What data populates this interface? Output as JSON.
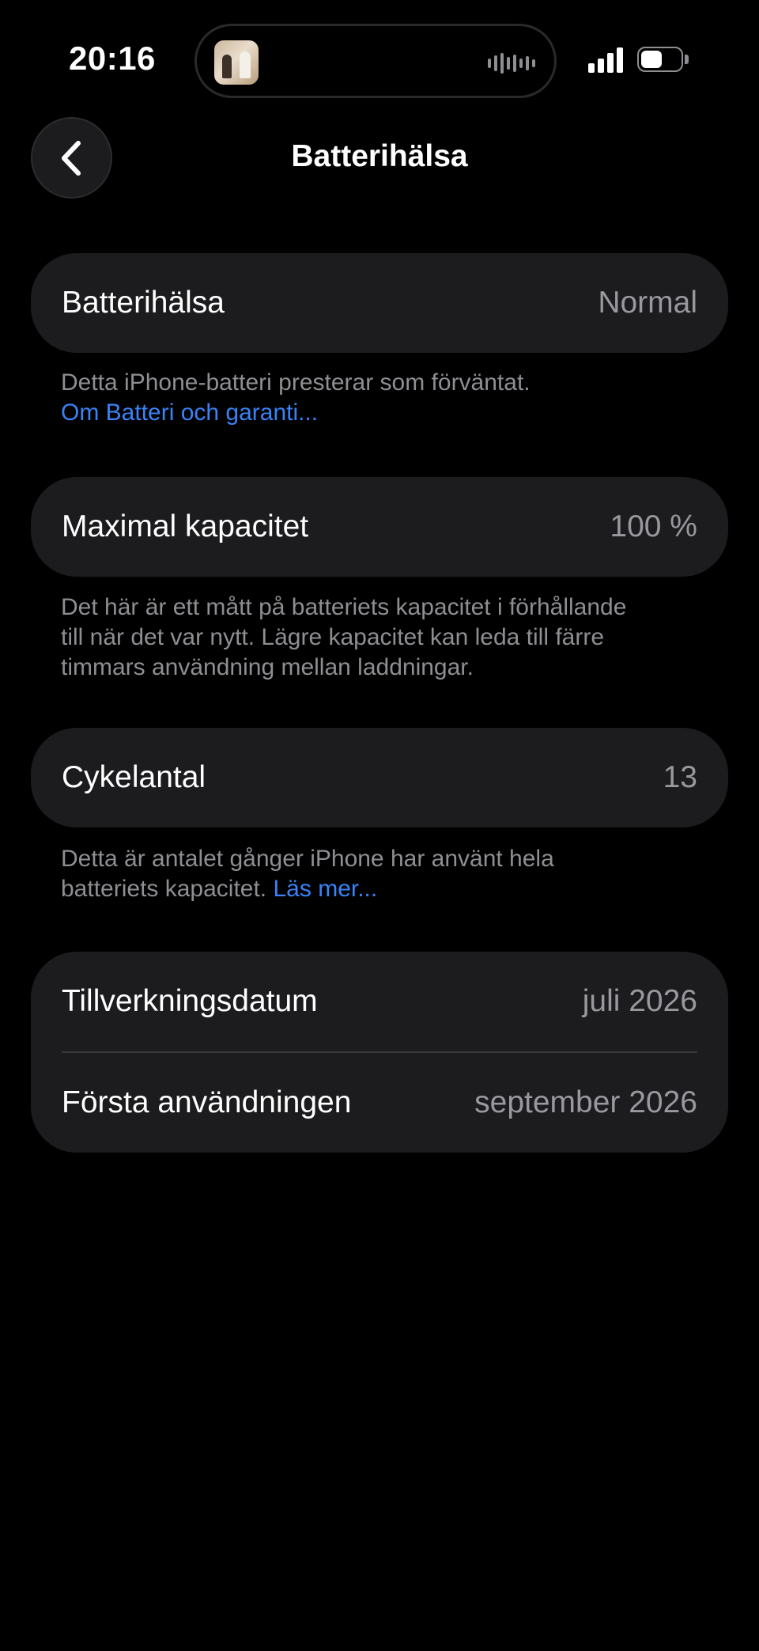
{
  "status_bar": {
    "time": "20:16"
  },
  "nav": {
    "title": "Batterihälsa",
    "back_icon": "chevron-left-icon"
  },
  "battery_health": {
    "label": "Batterihälsa",
    "value": "Normal",
    "footnote": "Detta iPhone-batteri presterar som förväntat.",
    "link": "Om Batteri och garanti..."
  },
  "max_capacity": {
    "label": "Maximal kapacitet",
    "value": "100 %",
    "footnote_lines": [
      "Det här är ett mått på batteriets kapacitet i förhållande",
      "till när det var nytt. Lägre kapacitet kan leda till färre",
      "timmars användning mellan laddningar."
    ]
  },
  "cycle_count": {
    "label": "Cykelantal",
    "value": "13",
    "footnote_line1": "Detta är antalet gånger iPhone har använt hela",
    "footnote_line2": "batteriets kapacitet.",
    "link": "Läs mer..."
  },
  "dates": {
    "manufacture_label": "Tillverkningsdatum",
    "manufacture_value": "juli 2026",
    "first_use_label": "Första användningen",
    "first_use_value": "september 2026"
  },
  "colors": {
    "background": "#000000",
    "card": "#1c1c1e",
    "secondary_text": "#98989f",
    "link": "#3a82f7"
  }
}
